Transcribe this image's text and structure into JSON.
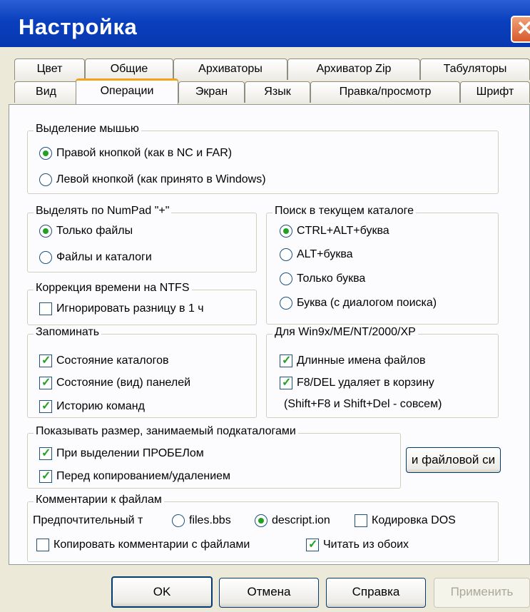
{
  "window": {
    "title": "Настройка",
    "close_icon": "close-icon"
  },
  "tabs_row1": [
    "Цвет",
    "Общие",
    "Архиваторы",
    "Архиватор Zip",
    "Табуляторы"
  ],
  "tabs_row2": [
    "Вид",
    "Операции",
    "Экран",
    "Язык",
    "Правка/просмотр",
    "Шрифт"
  ],
  "active_tab": "Операции",
  "mouse_selection": {
    "legend": "Выделение мышью",
    "right": "Правой кнопкой (как в NC и FAR)",
    "left": "Левой кнопкой (как принято в Windows)",
    "selected": "right"
  },
  "numpad": {
    "legend": "Выделять по NumPad \"+\"",
    "files_only": "Только файлы",
    "files_dirs": "Файлы и каталоги",
    "selected": "files_only"
  },
  "ntfs": {
    "legend": "Коррекция времени на NTFS",
    "ignore": "Игнорировать разницу в 1 ч",
    "checked": false
  },
  "search": {
    "legend": "Поиск в текущем каталоге",
    "ctrl_alt": "CTRL+ALT+буква",
    "alt": "ALT+буква",
    "letter_only": "Только буква",
    "letter_dialog": "Буква (с диалогом поиска)",
    "selected": "ctrl_alt"
  },
  "remember": {
    "legend": "Запоминать",
    "dirs_state": "Состояние каталогов",
    "panels_state": "Состояние (вид) панелей",
    "history": "Историю команд"
  },
  "win9x": {
    "legend": "Для Win9x/ME/NT/2000/XP",
    "long_names": "Длинные имена файлов",
    "f8_del": "F8/DEL удаляет в корзину",
    "f8_del_note": "(Shift+F8 и Shift+Del - совсем)"
  },
  "subdir_size": {
    "legend": "Показывать размер, занимаемый подкаталогами",
    "on_space": "При выделении ПРОБЕЛом",
    "before_copy": "Перед копированием/удалением",
    "fs_button": "и файловой си"
  },
  "comments": {
    "legend": "Комментарии к файлам",
    "preferred": "Предпочтительный т",
    "files_bbs": "files.bbs",
    "descript_ion": "descript.ion",
    "dos_encoding": "Кодировка DOS",
    "copy_comments": "Копировать комментарии с файлами",
    "read_both": "Читать из обоих",
    "selected": "descript_ion"
  },
  "buttons": {
    "ok": "OK",
    "cancel": "Отмена",
    "help": "Справка",
    "apply": "Применить"
  },
  "colors": {
    "titlebar": "#0a3fbd",
    "dialog_bg": "#ece9d8",
    "active_tab_accent": "#f3a21a",
    "radio_dot": "#21a121"
  }
}
